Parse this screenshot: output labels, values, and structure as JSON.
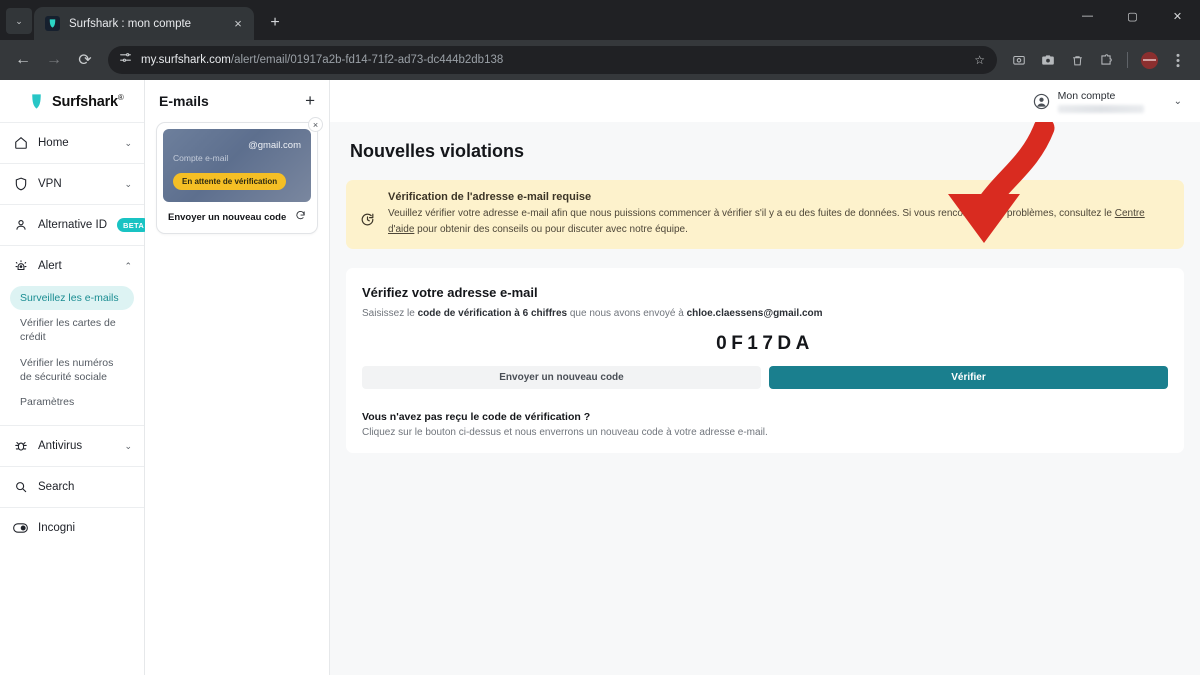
{
  "browser": {
    "tab": {
      "title": "Surfshark : mon compte",
      "favicon": "surfshark-icon",
      "close": "×"
    },
    "new_tab": "+",
    "tab_list_chevron": "⌄",
    "window_controls": {
      "minimize": "—",
      "maximize": "▢",
      "close": "✕"
    },
    "nav": {
      "back": "←",
      "forward": "→",
      "reload": "⟳"
    },
    "omnibox": {
      "site_settings_icon": "tune-icon",
      "url_host": "my.surfshark.com",
      "url_path": "/alert/email/01917a2b-fd14-71f2-ad73-dc444b2db138",
      "star_icon": "☆"
    },
    "toolbar_icons": [
      "screenshot-icon",
      "camera-icon",
      "trash-icon",
      "extensions-icon",
      "profile-avatar",
      "kebab-menu-icon"
    ]
  },
  "sidebar": {
    "brand": {
      "name": "Surfshark",
      "trademark": "®"
    },
    "items": [
      {
        "label": "Home",
        "icon": "home-icon",
        "chevron": "⌄"
      },
      {
        "label": "VPN",
        "icon": "shield-icon",
        "chevron": "⌄"
      },
      {
        "label": "Alternative ID",
        "icon": "person-icon",
        "badge": "BETA"
      },
      {
        "label": "Alert",
        "icon": "alert-icon",
        "chevron": "⌃"
      },
      {
        "label": "Antivirus",
        "icon": "bug-icon",
        "chevron": "⌄"
      },
      {
        "label": "Search",
        "icon": "search-icon"
      },
      {
        "label": "Incogni",
        "icon": "incogni-icon"
      }
    ],
    "alert_subitems": [
      {
        "label": "Surveillez les e-mails",
        "active": true
      },
      {
        "label": "Vérifier les cartes de crédit",
        "active": false
      },
      {
        "label": "Vérifier les numéros de sécurité sociale",
        "active": false
      },
      {
        "label": "Paramètres",
        "active": false
      }
    ]
  },
  "emails_panel": {
    "title": "E-mails",
    "add_icon": "+",
    "card": {
      "close_icon": "×",
      "email": "@gmail.com",
      "subtitle": "Compte e-mail",
      "status_badge": "En attente de vérification",
      "footer_label": "Envoyer un nouveau code",
      "footer_icon": "refresh-icon"
    }
  },
  "topbar": {
    "account_label": "Mon compte",
    "account_icon": "account-circle-icon",
    "chevron": "⌄"
  },
  "main": {
    "page_title": "Nouvelles violations",
    "banner": {
      "icon": "clock-refresh-icon",
      "title": "Vérification de l'adresse e-mail requise",
      "body_before_link": "Veuillez vérifier votre adresse e-mail afin que nous puissions commencer à vérifier s'il y a eu des fuites de données. Si vous rencontrez des problèmes, consultez le ",
      "link_text": "Centre d'aide",
      "body_after_link": " pour obtenir des conseils ou pour discuter avec notre équipe."
    },
    "verify_card": {
      "heading": "Vérifiez votre adresse e-mail",
      "desc_before": "Saisissez le ",
      "desc_bold": "code de vérification à 6 chiffres",
      "desc_middle": " que nous avons envoyé à ",
      "desc_email": "chloe.claessens@gmail.com",
      "code_value": "0F17DA",
      "code_placeholder": "",
      "resend_button": "Envoyer un nouveau code",
      "verify_button": "Vérifier",
      "footer_title": "Vous n'avez pas reçu le code de vérification ?",
      "footer_body": "Cliquez sur le bouton ci-dessus et nous enverrons un nouveau code à votre adresse e-mail."
    },
    "annotation": {
      "type": "curved-arrow",
      "color": "#d92b20",
      "points_to": "Vérifier"
    }
  },
  "colors": {
    "accent_teal": "#1a7f8e",
    "badge_teal": "#19c3c3",
    "banner_yellow": "#fdf2cc",
    "status_amber": "#f5bf25",
    "arrow_red": "#d92b20"
  }
}
